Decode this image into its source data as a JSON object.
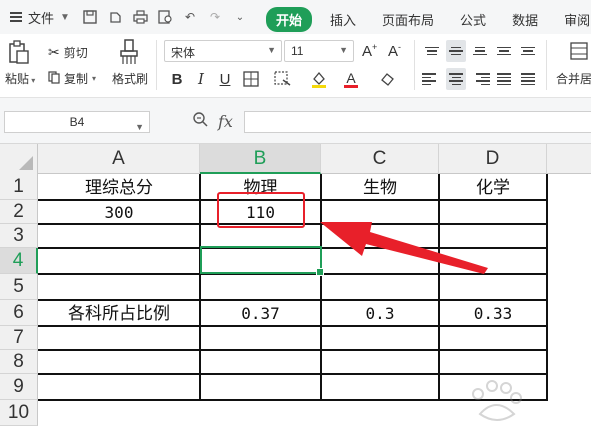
{
  "menu": {
    "file_label": "文件",
    "tabs": [
      {
        "label": "开始",
        "active": true
      },
      {
        "label": "插入",
        "active": false
      },
      {
        "label": "页面布局",
        "active": false
      },
      {
        "label": "公式",
        "active": false
      },
      {
        "label": "数据",
        "active": false
      },
      {
        "label": "审阅",
        "active": false
      }
    ]
  },
  "ribbon": {
    "paste_label": "粘贴",
    "cut_label": "剪切",
    "copy_label": "复制",
    "format_painter_label": "格式刷",
    "font_name": "宋体",
    "font_size": "11",
    "merge_label": "合并居"
  },
  "formula_bar": {
    "name_box": "B4",
    "fx_label": "fx",
    "formula": ""
  },
  "sheet": {
    "columns": [
      "A",
      "B",
      "C",
      "D"
    ],
    "selected_column": "B",
    "rows": [
      "1",
      "2",
      "3",
      "4",
      "5",
      "6",
      "7",
      "8",
      "9",
      "10"
    ],
    "selected_row": "4",
    "cells": {
      "A1": "理综总分",
      "B1": "物理",
      "C1": "生物",
      "D1": "化学",
      "A2": "300",
      "B2": "110",
      "A6": "各科所占比例",
      "B6": "0.37",
      "C6": "0.3",
      "D6": "0.33"
    }
  },
  "colors": {
    "accent": "#1f9e58",
    "highlight": "#e8202a"
  }
}
